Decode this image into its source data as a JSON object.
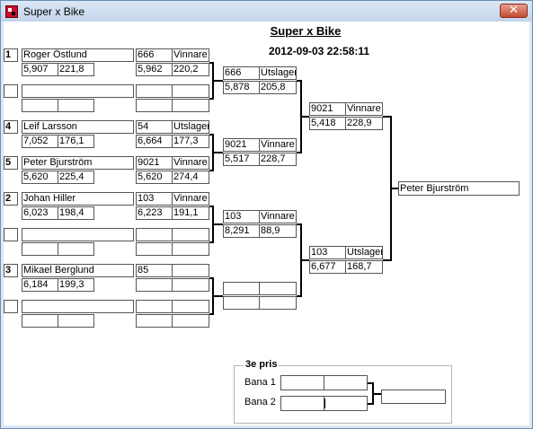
{
  "window": {
    "title": "Super x Bike",
    "close_glyph": "✕"
  },
  "header": {
    "title": "Super x Bike",
    "datetime": "2012-09-03 22:58:11"
  },
  "round1": [
    {
      "seed": "1",
      "name": "Roger Östlund",
      "time": "5,907",
      "speed": "221,8"
    },
    {
      "seed": "",
      "name": "",
      "time": "",
      "speed": ""
    },
    {
      "seed": "4",
      "name": "Leif Larsson",
      "time": "7,052",
      "speed": "176,1"
    },
    {
      "seed": "5",
      "name": "Peter Bjurström",
      "time": "5,620",
      "speed": "225,4"
    },
    {
      "seed": "2",
      "name": "Johan Hiller",
      "time": "6,023",
      "speed": "198,4"
    },
    {
      "seed": "",
      "name": "",
      "time": "",
      "speed": ""
    },
    {
      "seed": "3",
      "name": "Mikael Berglund",
      "time": "6,184",
      "speed": "199,3"
    },
    {
      "seed": "",
      "name": "",
      "time": "",
      "speed": ""
    }
  ],
  "round2": [
    {
      "num": "666",
      "result": "Vinnare",
      "time": "5,962",
      "speed": "220,2"
    },
    {
      "num": "",
      "result": "",
      "time": "",
      "speed": ""
    },
    {
      "num": "54",
      "result": "Utslagen",
      "time": "6,664",
      "speed": "177,3"
    },
    {
      "num": "9021",
      "result": "Vinnare",
      "time": "5,620",
      "speed": "274,4"
    },
    {
      "num": "103",
      "result": "Vinnare",
      "time": "6,223",
      "speed": "191,1"
    },
    {
      "num": "",
      "result": "",
      "time": "",
      "speed": ""
    },
    {
      "num": "85",
      "result": "",
      "time": "",
      "speed": ""
    },
    {
      "num": "",
      "result": "",
      "time": "",
      "speed": ""
    }
  ],
  "round3": [
    {
      "num": "666",
      "result": "Utslagen",
      "time": "5,878",
      "speed": "205,8"
    },
    {
      "num": "9021",
      "result": "Vinnare",
      "time": "5,517",
      "speed": "228,7"
    },
    {
      "num": "103",
      "result": "Vinnare",
      "time": "8,291",
      "speed": "88,9"
    },
    {
      "num": "",
      "result": "",
      "time": "",
      "speed": ""
    }
  ],
  "round4": [
    {
      "num": "9021",
      "result": "Vinnare",
      "time": "5,418",
      "speed": "228,9"
    },
    {
      "num": "103",
      "result": "Utslagen",
      "time": "6,677",
      "speed": "168,7"
    }
  ],
  "winner": {
    "name": "Peter Bjurström"
  },
  "third_place": {
    "legend": "3e pris",
    "lane1_label": "Bana 1",
    "lane2_label": "Bana 2",
    "lane1": [
      "",
      ""
    ],
    "lane2": [
      "",
      ""
    ],
    "result": ""
  }
}
